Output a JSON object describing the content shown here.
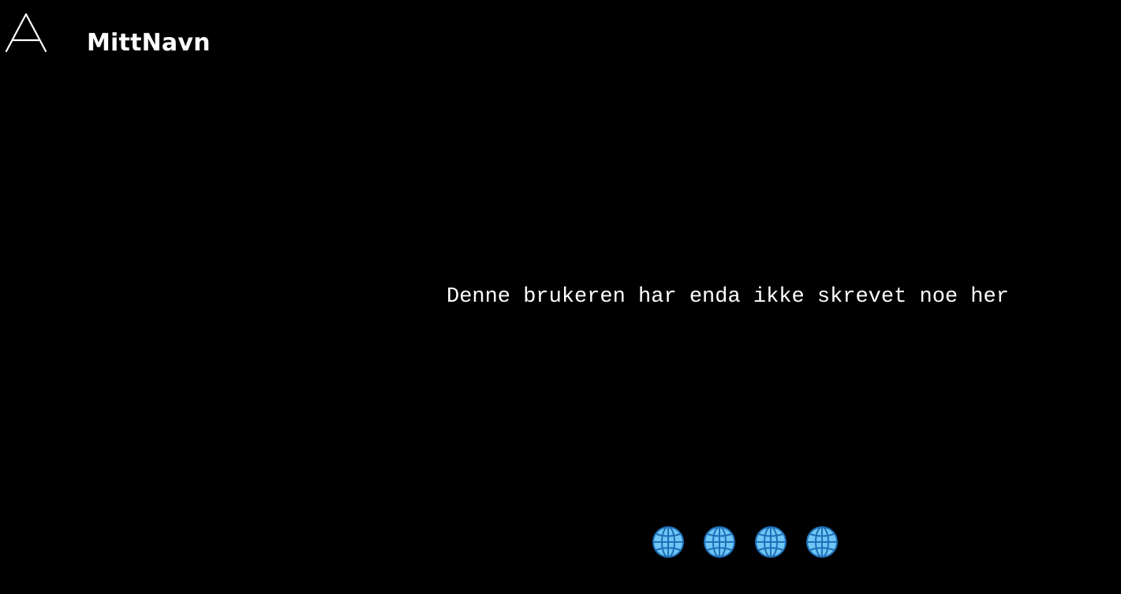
{
  "header": {
    "logo_icon": "triangle-a-logo-icon",
    "site_name": "MittNavn"
  },
  "main": {
    "bio_text": "Denne brukeren har enda ikke skrevet noe her"
  },
  "footer": {
    "link_icons": [
      "globe-icon",
      "globe-icon",
      "globe-icon",
      "globe-icon"
    ]
  },
  "colors": {
    "background": "#000000",
    "text": "#ffffff",
    "globe_fill": "#6ec6f5",
    "globe_stroke": "#1f6fb8"
  }
}
